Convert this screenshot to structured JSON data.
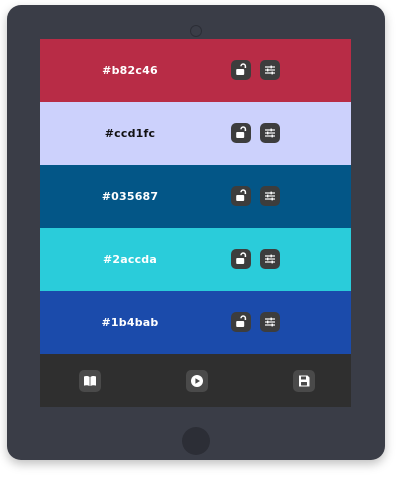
{
  "palette": {
    "colors": [
      {
        "hex_label": "#b82c46",
        "bg": "#b82c46",
        "text_color": "#ffffff",
        "locked": false
      },
      {
        "hex_label": "#ccd1fc",
        "bg": "#ccd1fc",
        "text_color": "#111111",
        "locked": false
      },
      {
        "hex_label": "#035687",
        "bg": "#035687",
        "text_color": "#ffffff",
        "locked": false
      },
      {
        "hex_label": "#2accda",
        "bg": "#2accda",
        "text_color": "#ffffff",
        "locked": false
      },
      {
        "hex_label": "#1b4bab",
        "bg": "#1b4bab",
        "text_color": "#ffffff",
        "locked": false
      }
    ]
  },
  "toolbar": {
    "buttons": [
      {
        "icon": "book-icon"
      },
      {
        "icon": "play-icon"
      },
      {
        "icon": "save-icon"
      }
    ]
  },
  "device": {
    "frame_color": "#3a3d47",
    "screen_bg": "#2f2f2f"
  }
}
